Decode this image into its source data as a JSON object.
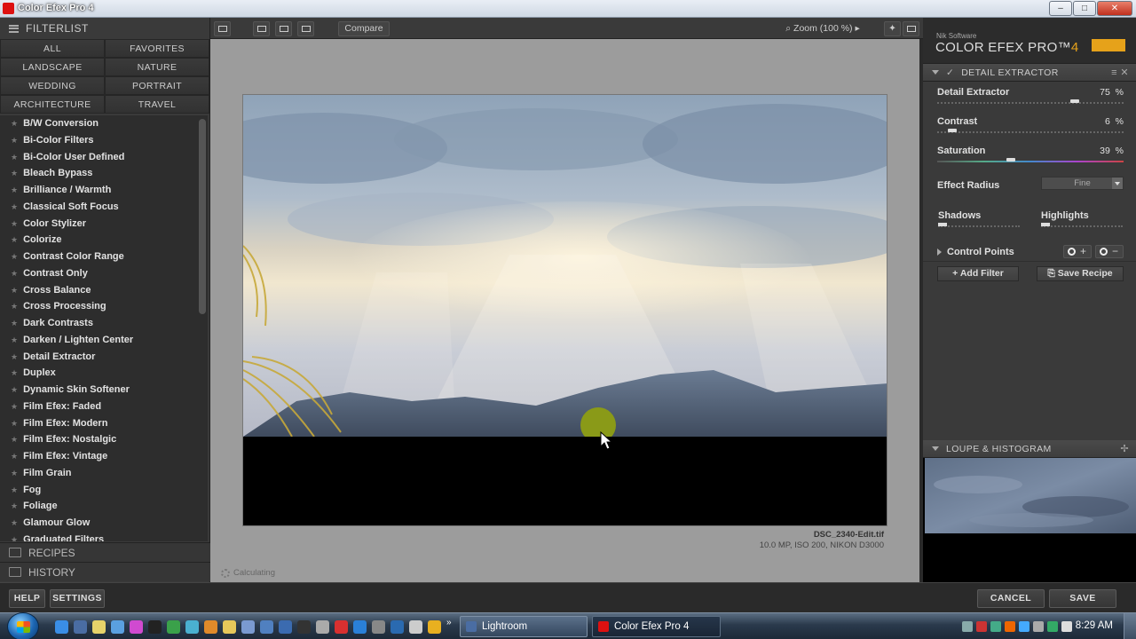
{
  "window": {
    "title": "Color Efex Pro 4"
  },
  "left": {
    "filterlist_label": "FILTERLIST",
    "categories": [
      "ALL",
      "FAVORITES",
      "LANDSCAPE",
      "NATURE",
      "WEDDING",
      "PORTRAIT",
      "ARCHITECTURE",
      "TRAVEL"
    ],
    "filters": [
      "B/W Conversion",
      "Bi-Color Filters",
      "Bi-Color User Defined",
      "Bleach Bypass",
      "Brilliance / Warmth",
      "Classical Soft Focus",
      "Color Stylizer",
      "Colorize",
      "Contrast Color Range",
      "Contrast Only",
      "Cross Balance",
      "Cross Processing",
      "Dark Contrasts",
      "Darken / Lighten Center",
      "Detail Extractor",
      "Duplex",
      "Dynamic Skin Softener",
      "Film Efex: Faded",
      "Film Efex: Modern",
      "Film Efex: Nostalgic",
      "Film Efex: Vintage",
      "Film Grain",
      "Fog",
      "Foliage",
      "Glamour Glow",
      "Graduated Filters"
    ],
    "recipes_label": "RECIPES",
    "history_label": "HISTORY"
  },
  "toolbar": {
    "compare_label": "Compare",
    "zoom_label": "Zoom (100 %)"
  },
  "canvas": {
    "file_name": "DSC_2340-Edit.tif",
    "file_meta": "10.0 MP, ISO 200, NIKON D3000",
    "status": "Calculating"
  },
  "right": {
    "brand_small": "Nik Software",
    "brand_name": "COLOR EFEX PRO™",
    "brand_version": "4",
    "filter_header": "DETAIL EXTRACTOR",
    "sliders": [
      {
        "label": "Detail Extractor",
        "value": "75",
        "unit": "%",
        "percent": 75
      },
      {
        "label": "Contrast",
        "value": "6",
        "unit": "%",
        "percent": 6
      },
      {
        "label": "Saturation",
        "value": "39",
        "unit": "%",
        "percent": 39
      }
    ],
    "effect_radius_label": "Effect Radius",
    "effect_radius_value": "Fine",
    "shadows_label": "Shadows",
    "highlights_label": "Highlights",
    "control_points_label": "Control Points",
    "add_filter_label": "Add Filter",
    "save_recipe_label": "Save Recipe",
    "loupe_label": "LOUPE & HISTOGRAM"
  },
  "bottom": {
    "help_label": "HELP",
    "settings_label": "SETTINGS",
    "cancel_label": "CANCEL",
    "save_label": "SAVE"
  },
  "taskbar": {
    "tasks": [
      "Lightroom",
      "Color Efex Pro 4"
    ],
    "clock": "8:29 AM"
  }
}
